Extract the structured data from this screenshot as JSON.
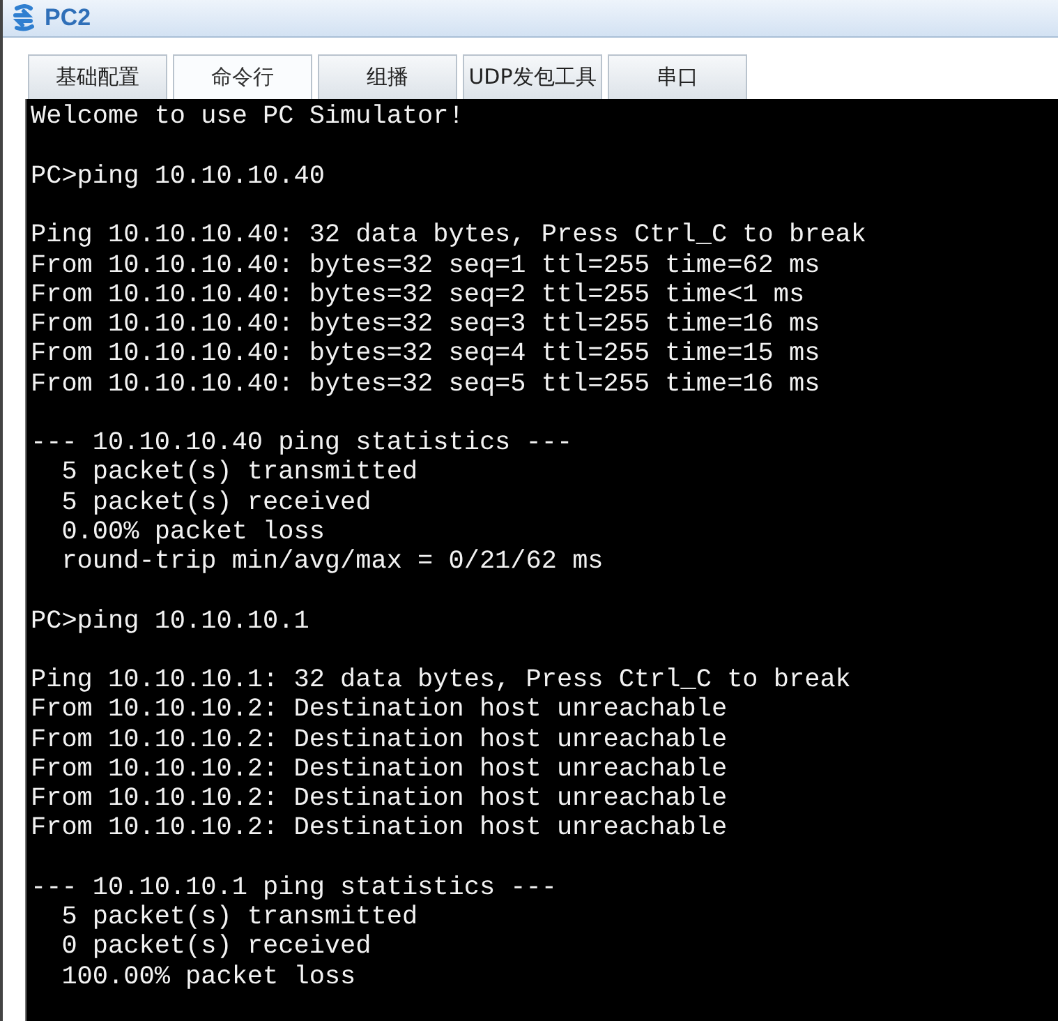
{
  "window": {
    "title": "PC2"
  },
  "tabs": [
    {
      "label": "基础配置",
      "selected": false
    },
    {
      "label": "命令行",
      "selected": true
    },
    {
      "label": "组播",
      "selected": false
    },
    {
      "label": "UDP发包工具",
      "selected": false
    },
    {
      "label": "串口",
      "selected": false
    }
  ],
  "terminal": {
    "blocks": [
      [
        "Welcome to use PC Simulator!"
      ],
      [
        "PC>ping 10.10.10.40"
      ],
      [
        "Ping 10.10.10.40: 32 data bytes, Press Ctrl_C to break",
        "From 10.10.10.40: bytes=32 seq=1 ttl=255 time=62 ms",
        "From 10.10.10.40: bytes=32 seq=2 ttl=255 time<1 ms",
        "From 10.10.10.40: bytes=32 seq=3 ttl=255 time=16 ms",
        "From 10.10.10.40: bytes=32 seq=4 ttl=255 time=15 ms",
        "From 10.10.10.40: bytes=32 seq=5 ttl=255 time=16 ms"
      ],
      [
        "--- 10.10.10.40 ping statistics ---",
        "  5 packet(s) transmitted",
        "  5 packet(s) received",
        "  0.00% packet loss",
        "  round-trip min/avg/max = 0/21/62 ms"
      ],
      [
        "PC>ping 10.10.10.1"
      ],
      [
        "Ping 10.10.10.1: 32 data bytes, Press Ctrl_C to break",
        "From 10.10.10.2: Destination host unreachable",
        "From 10.10.10.2: Destination host unreachable",
        "From 10.10.10.2: Destination host unreachable",
        "From 10.10.10.2: Destination host unreachable",
        "From 10.10.10.2: Destination host unreachable"
      ],
      [
        "--- 10.10.10.1 ping statistics ---",
        "  5 packet(s) transmitted",
        "  0 packet(s) received",
        "  100.00% packet loss"
      ]
    ]
  }
}
